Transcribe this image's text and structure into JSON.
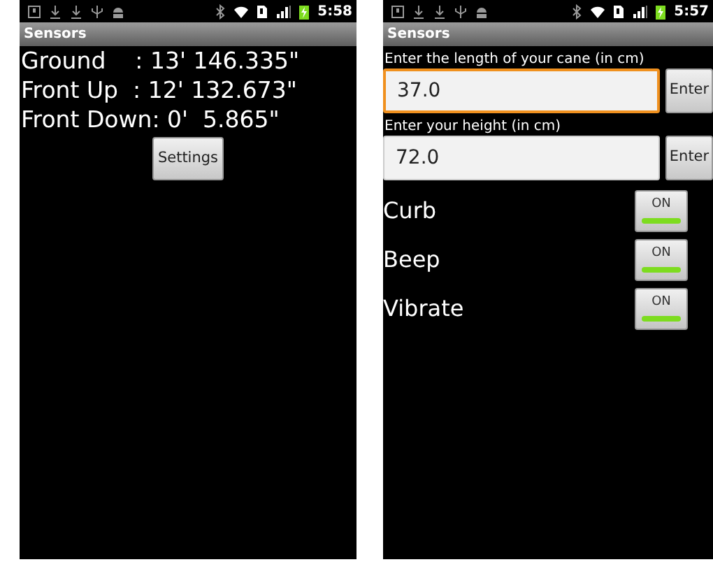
{
  "screens": [
    {
      "kind": "readings",
      "status_bar": {
        "time": "5:58"
      },
      "title": "Sensors",
      "readings": [
        {
          "label": "Ground    : 13' 146.335\""
        },
        {
          "label": "Front Up  : 12' 132.673\""
        },
        {
          "label": "Front Down: 0'  5.865\""
        }
      ],
      "button": "Settings"
    },
    {
      "kind": "settings",
      "status_bar": {
        "time": "5:57"
      },
      "title": "Sensors",
      "fields": [
        {
          "label": "Enter the length of your cane (in cm)",
          "value": "37.0",
          "focused": true,
          "button": "Enter"
        },
        {
          "label": "Enter your height (in cm)",
          "value": "72.0",
          "focused": false,
          "button": "Enter"
        }
      ],
      "toggles": [
        {
          "label": "Curb",
          "state": "ON",
          "on": true
        },
        {
          "label": "Beep",
          "state": "ON",
          "on": true
        },
        {
          "label": "Vibrate",
          "state": "ON",
          "on": true
        }
      ]
    }
  ]
}
